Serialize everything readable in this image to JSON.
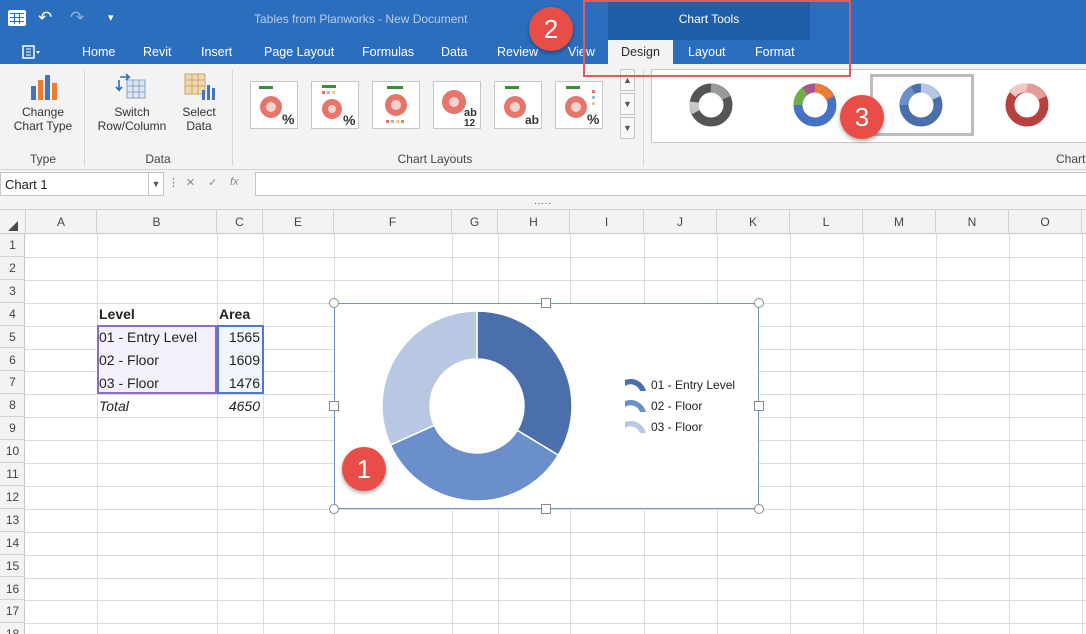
{
  "titlebar": {
    "doc_title": "Tables from Planworks - New Document",
    "contextual_group": "Chart Tools"
  },
  "tabs": [
    "Home",
    "Revit",
    "Insert",
    "Page Layout",
    "Formulas",
    "Data",
    "Review",
    "View",
    "Design",
    "Layout",
    "Format"
  ],
  "ribbon": {
    "change_chart_type": [
      "Change",
      "Chart Type"
    ],
    "switch_row_column": [
      "Switch",
      "Row/Column"
    ],
    "select_data": [
      "Select",
      "Data"
    ],
    "group_type": "Type",
    "group_data": "Data",
    "group_layouts": "Chart Layouts",
    "group_styles": "Chart",
    "layout_labels": [
      "%",
      "%",
      "",
      "ab\n12",
      "ab",
      "%"
    ]
  },
  "formula_bar": {
    "name_box": "Chart 1",
    "formula": ""
  },
  "columns": [
    "A",
    "B",
    "C",
    "E",
    "F",
    "G",
    "H",
    "I",
    "J",
    "K",
    "L",
    "M",
    "N",
    "O"
  ],
  "rows": [
    "1",
    "2",
    "3",
    "4",
    "5",
    "6",
    "7",
    "8",
    "9",
    "10",
    "11",
    "12",
    "13",
    "14",
    "15",
    "16",
    "17",
    "18"
  ],
  "table": {
    "header_level": "Level",
    "header_area": "Area",
    "rows": [
      {
        "level": "01 - Entry Level",
        "area": "1565"
      },
      {
        "level": "02 - Floor",
        "area": "1609"
      },
      {
        "level": "03 - Floor",
        "area": "1476"
      }
    ],
    "total_label": "Total",
    "total_value": "4650"
  },
  "chart_data": {
    "type": "pie",
    "subtype": "doughnut",
    "categories": [
      "01 - Entry Level",
      "02 - Floor",
      "03 - Floor"
    ],
    "values": [
      1565,
      1609,
      1476
    ],
    "colors": [
      "#4a6faa",
      "#6b8fcb",
      "#b8c8e3"
    ],
    "legend_position": "right"
  },
  "callouts": {
    "one": "1",
    "two": "2",
    "three": "3"
  },
  "colors": {
    "accent": "#2b6ebd",
    "contextual": "#1f5ea8",
    "callout": "#e84d47"
  }
}
